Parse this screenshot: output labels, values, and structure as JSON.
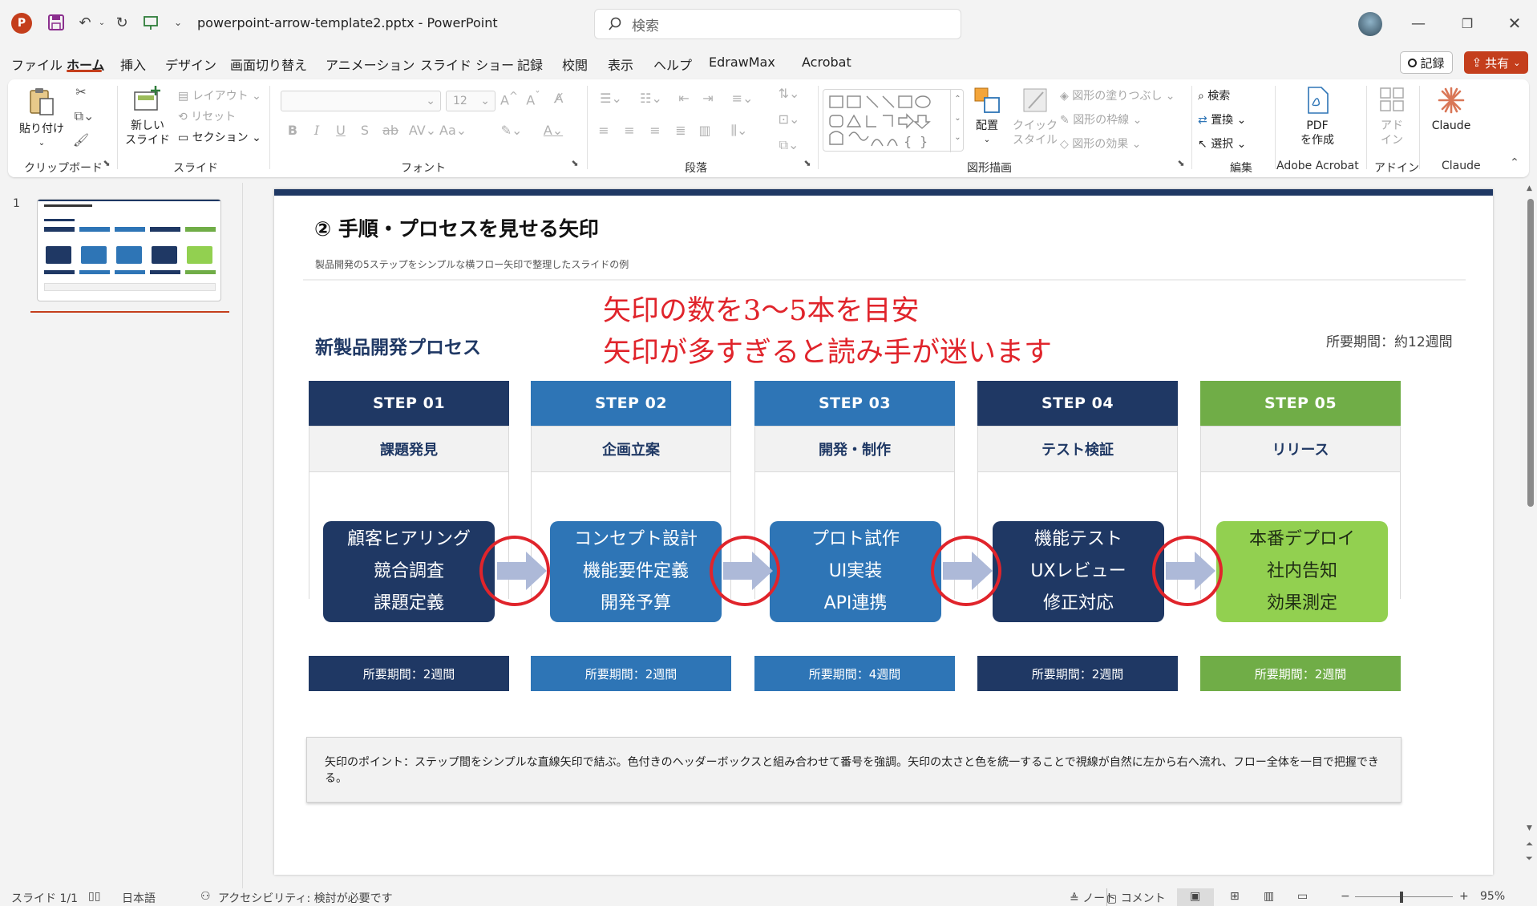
{
  "titlebar": {
    "document_title": "powerpoint-arrow-template2.pptx  -  PowerPoint",
    "search_placeholder": "検索"
  },
  "menu": {
    "items": [
      "ファイル",
      "ホーム",
      "挿入",
      "デザイン",
      "画面切り替え",
      "アニメーション",
      "スライド ショー",
      "記録",
      "校閲",
      "表示",
      "ヘルプ",
      "EdrawMax",
      "Acrobat"
    ],
    "active": "ホーム",
    "record_label": "記録",
    "share_label": "共有"
  },
  "ribbon": {
    "clipboard": {
      "paste": "貼り付け",
      "group": "クリップボード"
    },
    "slides": {
      "new_slide_1": "新しい",
      "new_slide_2": "スライド",
      "layout": "レイアウト",
      "reset": "リセット",
      "section": "セクション",
      "group": "スライド"
    },
    "font": {
      "size": "12",
      "group": "フォント"
    },
    "paragraph": {
      "group": "段落"
    },
    "drawing": {
      "arrange": "配置",
      "quick_style_1": "クイック",
      "quick_style_2": "スタイル",
      "fill": "図形の塗りつぶし",
      "outline": "図形の枠線",
      "effects": "図形の効果",
      "group": "図形描画"
    },
    "editing": {
      "find": "検索",
      "replace": "置換",
      "select": "選択",
      "group": "編集"
    },
    "acrobat": {
      "pdf_1": "PDF",
      "pdf_2": "を作成",
      "group": "Adobe Acrobat"
    },
    "addins": {
      "label_1": "アド",
      "label_2": "イン",
      "group": "アドイン"
    },
    "claude": {
      "label": "Claude",
      "group": "Claude"
    }
  },
  "thumbnail": {
    "number": "1"
  },
  "slide": {
    "heading": "② 手順・プロセスを見せる矢印",
    "subheading": "製品開発の5ステップをシンプルな横フロー矢印で整理したスライドの例",
    "section_title": "新製品開発プロセス",
    "callout_line1": "矢印の数を3～5本を目安",
    "callout_line2": "矢印が多すぎると読み手が迷います",
    "duration_total": "所要期間：約12週間",
    "steps": [
      {
        "label": "STEP 01",
        "title": "課題発見",
        "items": [
          "顧客ヒアリング",
          "競合調査",
          "課題定義"
        ],
        "duration": "所要期間：2週間"
      },
      {
        "label": "STEP 02",
        "title": "企画立案",
        "items": [
          "コンセプト設計",
          "機能要件定義",
          "開発予算"
        ],
        "duration": "所要期間：2週間"
      },
      {
        "label": "STEP 03",
        "title": "開発・制作",
        "items": [
          "プロト試作",
          "UI実装",
          "API連携"
        ],
        "duration": "所要期間：4週間"
      },
      {
        "label": "STEP 04",
        "title": "テスト検証",
        "items": [
          "機能テスト",
          "UXレビュー",
          "修正対応"
        ],
        "duration": "所要期間：2週間"
      },
      {
        "label": "STEP 05",
        "title": "リリース",
        "items": [
          "本番デプロイ",
          "社内告知",
          "効果測定"
        ],
        "duration": "所要期間：2週間"
      }
    ],
    "note": "矢印のポイント：ステップ間をシンプルな直線矢印で結ぶ。色付きのヘッダーボックスと組み合わせて番号を強調。矢印の太さと色を統一することで視線が自然に左から右へ流れ、フロー全体を一目で把握できる。"
  },
  "statusbar": {
    "slide_count": "スライド 1/1",
    "language": "日本語",
    "accessibility": "アクセシビリティ: 検討が必要です",
    "notes": "ノート",
    "comments": "コメント",
    "zoom": "95%"
  },
  "colors": {
    "navy": "#1f3864",
    "blue": "#2e75b6",
    "green": "#70ad47",
    "light_green": "#92d050",
    "callout_red": "#e0242b",
    "arrow": "#adb9d8",
    "accent": "#c43e1c"
  }
}
